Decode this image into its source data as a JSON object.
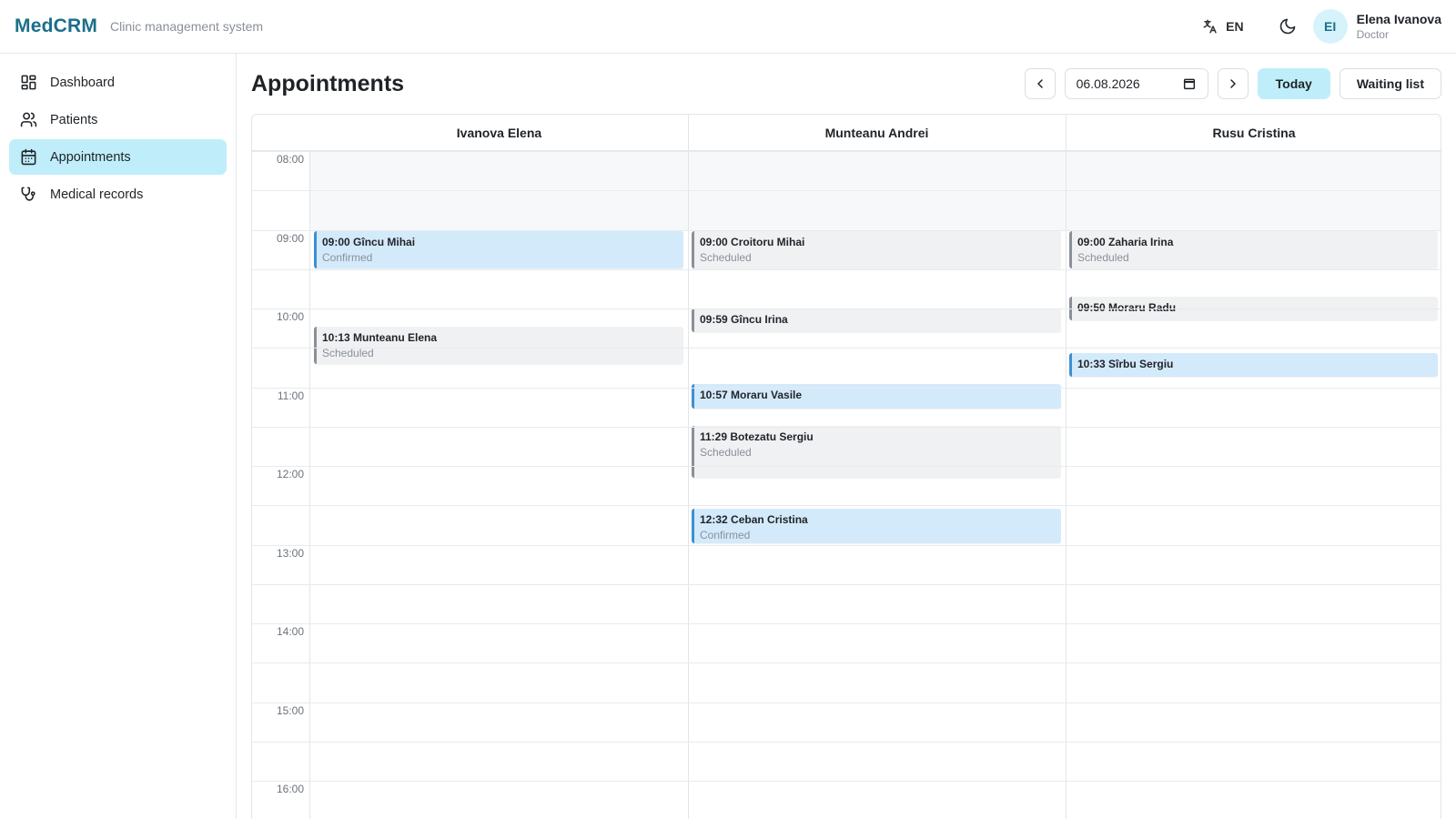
{
  "header": {
    "logo": "MedCRM",
    "tagline": "Clinic management system",
    "language": "EN",
    "user": {
      "initials": "EI",
      "name": "Elena Ivanova",
      "role": "Doctor"
    }
  },
  "sidebar": {
    "items": [
      {
        "label": "Dashboard",
        "icon": "dashboard-icon",
        "active": false
      },
      {
        "label": "Patients",
        "icon": "users-icon",
        "active": false
      },
      {
        "label": "Appointments",
        "icon": "calendar-icon",
        "active": true
      },
      {
        "label": "Medical records",
        "icon": "stethoscope-icon",
        "active": false
      }
    ]
  },
  "main": {
    "title": "Appointments",
    "date": "06.08.2026",
    "today_label": "Today",
    "waiting_list_label": "Waiting list"
  },
  "calendar": {
    "time_labels": [
      "08:00",
      "09:00",
      "10:00",
      "11:00",
      "12:00",
      "13:00",
      "14:00",
      "15:00",
      "16:00"
    ],
    "doctors": [
      "Ivanova Elena",
      "Munteanu Andrei",
      "Rusu Cristina"
    ],
    "appointments": [
      {
        "doctor": 0,
        "title": "09:00 Gîncu Mihai",
        "status": "Confirmed",
        "start": "09:00",
        "end": "09:30",
        "state": "confirmed"
      },
      {
        "doctor": 0,
        "title": "10:13 Munteanu Elena",
        "status": "Scheduled",
        "start": "10:13",
        "end": "10:43",
        "state": "scheduled"
      },
      {
        "doctor": 1,
        "title": "09:00 Croitoru Mihai",
        "status": "Scheduled",
        "start": "09:00",
        "end": "09:30",
        "state": "scheduled"
      },
      {
        "doctor": 1,
        "title": "09:59 Gîncu Irina",
        "status": "",
        "start": "09:59",
        "end": "10:19",
        "state": "scheduled"
      },
      {
        "doctor": 1,
        "title": "10:57 Moraru Vasile",
        "status": "",
        "start": "10:57",
        "end": "11:17",
        "state": "confirmed"
      },
      {
        "doctor": 1,
        "title": "11:29 Botezatu Sergiu",
        "status": "Scheduled",
        "start": "11:29",
        "end": "12:10",
        "state": "scheduled"
      },
      {
        "doctor": 1,
        "title": "12:32 Ceban Cristina",
        "status": "Confirmed",
        "start": "12:32",
        "end": "13:00",
        "state": "confirmed"
      },
      {
        "doctor": 2,
        "title": "09:00 Zaharia Irina",
        "status": "Scheduled",
        "start": "09:00",
        "end": "09:30",
        "state": "scheduled"
      },
      {
        "doctor": 2,
        "title": "09:50 Moraru Radu",
        "status": "",
        "start": "09:50",
        "end": "10:10",
        "state": "scheduled"
      },
      {
        "doctor": 2,
        "title": "10:33 Sîrbu Sergiu",
        "status": "",
        "start": "10:33",
        "end": "10:53",
        "state": "confirmed"
      }
    ]
  },
  "colors": {
    "brand": "#1b6f8a",
    "accent": "#bfeefa",
    "confirmed_bg": "#d3eafb",
    "confirmed_border": "#3d8fd0",
    "scheduled_bg": "#f0f1f3",
    "scheduled_border": "#8a9098"
  }
}
